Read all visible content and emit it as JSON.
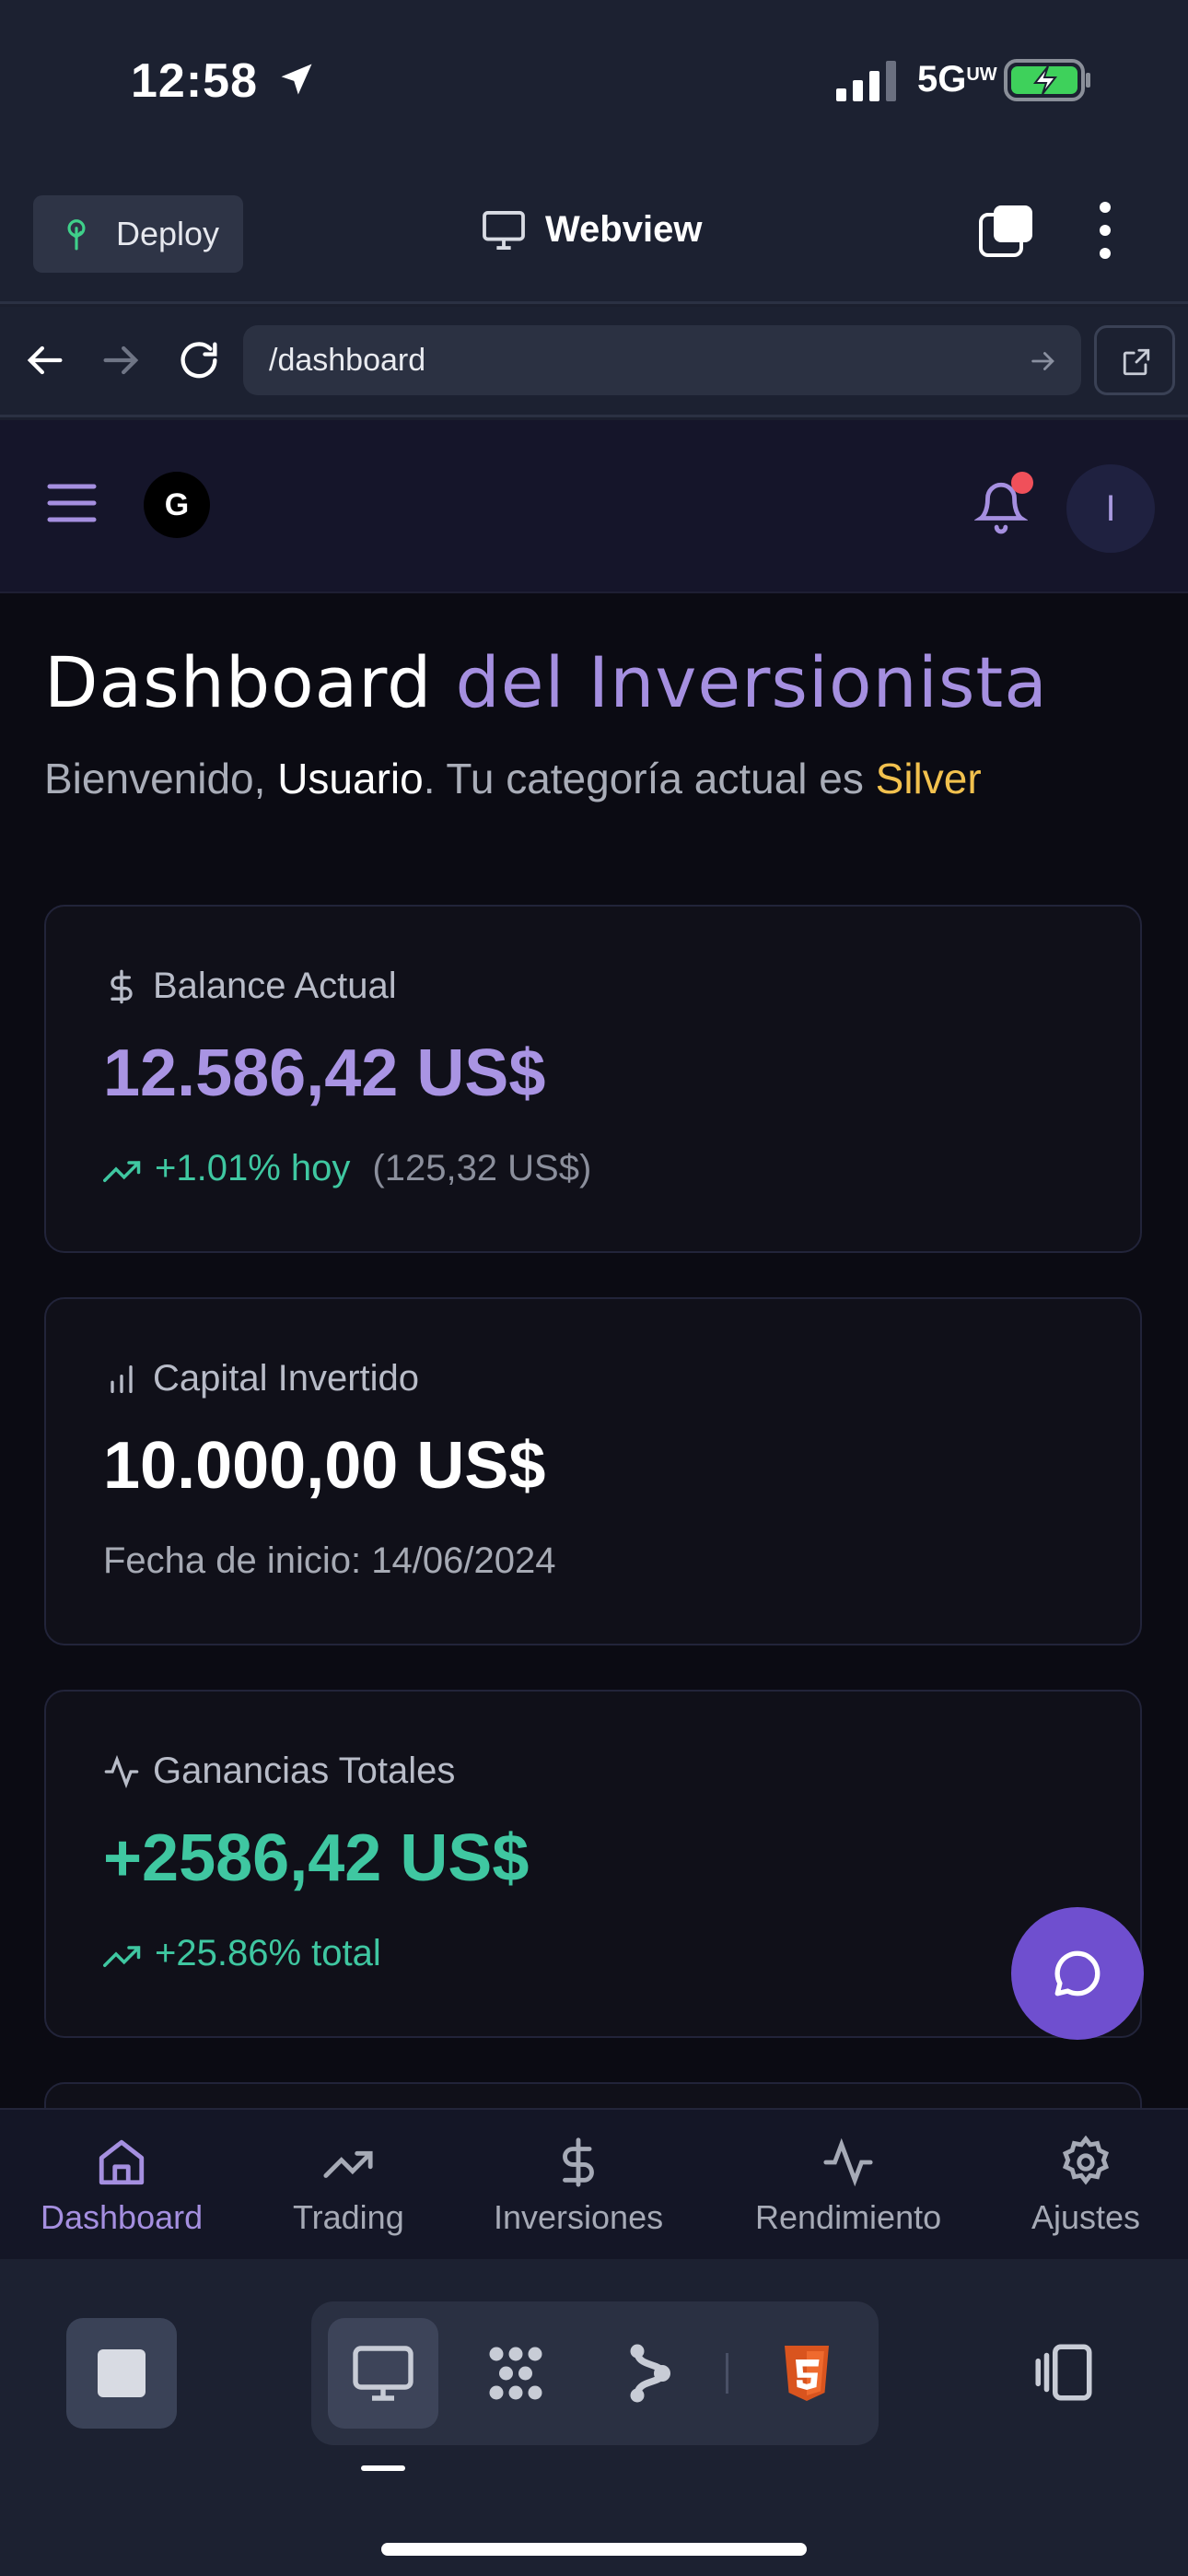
{
  "status_bar": {
    "time": "12:58",
    "network": "5G",
    "network_badge": "UW"
  },
  "webview_header": {
    "deploy_label": "Deploy",
    "title": "Webview"
  },
  "address_bar": {
    "url": "/dashboard"
  },
  "app": {
    "logo_letter": "G",
    "avatar_letter": "I",
    "title_main": "Dashboard",
    "title_accent": "del Inversionista",
    "welcome": {
      "prefix": "Bienvenido, ",
      "user": "Usuario",
      "middle": ". Tu categoría actual es ",
      "tier": "Silver"
    },
    "cards": [
      {
        "label": "Balance Actual",
        "value": "12.586,42 US$",
        "change": "+1.01% hoy",
        "change_detail": "(125,32 US$)"
      },
      {
        "label": "Capital Invertido",
        "value": "10.000,00 US$",
        "detail": "Fecha de inicio: 14/06/2024"
      },
      {
        "label": "Ganancias Totales",
        "value": "+2586,42 US$",
        "change": "+25.86% total"
      }
    ],
    "nav": [
      {
        "label": "Dashboard",
        "active": true
      },
      {
        "label": "Trading"
      },
      {
        "label": "Inversiones"
      },
      {
        "label": "Rendimiento"
      },
      {
        "label": "Ajustes"
      }
    ]
  },
  "colors": {
    "accent": "#a58fe0",
    "positive": "#3fc7a1",
    "tier": "#f2c14e",
    "fab": "#6f4fcf"
  }
}
